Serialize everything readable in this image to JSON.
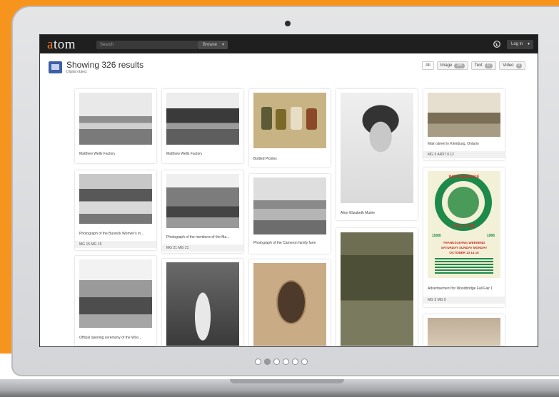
{
  "app": {
    "logo_a": "a",
    "logo_rest": "tom",
    "search_placeholder": "Search",
    "browse_label": "Browse",
    "login_label": "Log in"
  },
  "results": {
    "title": "Showing 326 results",
    "subtitle": "Digital object"
  },
  "filters": [
    {
      "label": "All",
      "count": ""
    },
    {
      "label": "Image",
      "count": "285"
    },
    {
      "label": "Text",
      "count": "37"
    },
    {
      "label": "Video",
      "count": "0"
    }
  ],
  "cards": [
    {
      "caption": "Matthew Wells Factory",
      "id": ""
    },
    {
      "caption": "Matthew Wells Factory",
      "id": ""
    },
    {
      "caption": "Bottled Pickles",
      "id": ""
    },
    {
      "caption": "Alice Elizabeth Mutrie",
      "id": ""
    },
    {
      "caption": "Main street in Kleinburg, Ontario",
      "id": "MG 5 AR97.0.12"
    },
    {
      "caption": "Photograph of the Burwick Women's In...",
      "id": "MG 15 MG 15"
    },
    {
      "caption": "Photograph of the members of the Ma...",
      "id": "MG 21 MG 21"
    },
    {
      "caption": "Photograph of the Cameron family farm",
      "id": ""
    },
    {
      "caption": "",
      "id": ""
    },
    {
      "caption": "Advertisement for Woodbridge Fall Fair 1",
      "id": "MG 5 MG 5"
    },
    {
      "caption": "Official opening ceremony of the Woo...",
      "id": ""
    },
    {
      "caption": "",
      "id": ""
    },
    {
      "caption": "",
      "id": ""
    },
    {
      "caption": "",
      "id": ""
    }
  ],
  "poster": {
    "top": "WOODBRIDGE",
    "middle": "FALL FAIR",
    "year_left": "150th",
    "year_right": "1995",
    "line1": "THANKSGIVING WEEKEND",
    "line2": "SATURDAY SUNDAY MONDAY",
    "line3": "OCTOBER 13 14 15"
  },
  "carousel": {
    "count": 6,
    "active_index": 1
  },
  "colors": {
    "background": "#f7941d",
    "logo_accent": "#f47a20",
    "topbar": "#1f1f1f",
    "result_icon": "#3e5fa7"
  },
  "icons": [
    "globe-icon",
    "digital-object-icon",
    "chevron-down-icon"
  ]
}
